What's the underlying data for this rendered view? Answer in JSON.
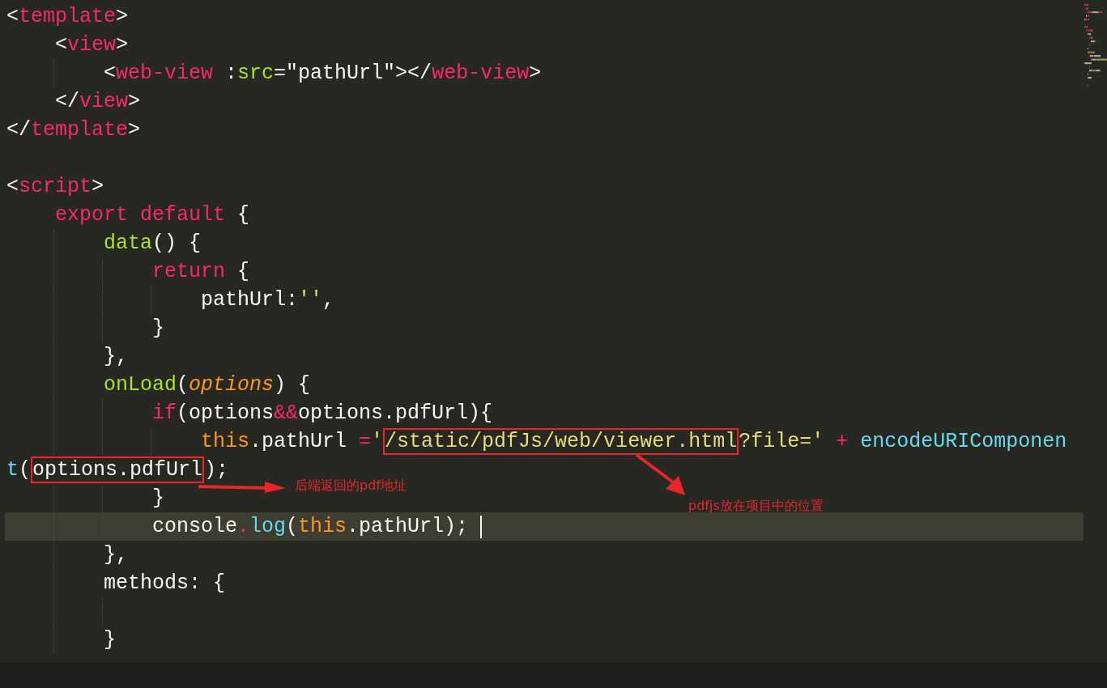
{
  "editor": {
    "lines": [
      {
        "kind": "code",
        "tokens": [
          {
            "text": "<",
            "kind": "punct"
          },
          {
            "text": "template",
            "kind": "tag"
          },
          {
            "text": ">",
            "kind": "punct"
          }
        ],
        "children": [
          {
            "kind": "code",
            "tokens": [
              {
                "text": "<",
                "kind": "punct"
              },
              {
                "text": "view",
                "kind": "tag"
              },
              {
                "text": ">",
                "kind": "punct"
              }
            ],
            "children": [
              {
                "kind": "code",
                "tokens": [
                  {
                    "text": "<",
                    "kind": "punct"
                  },
                  {
                    "text": "web-view",
                    "kind": "tag"
                  },
                  {
                    "text": " :",
                    "kind": "punct"
                  },
                  {
                    "text": "src",
                    "kind": "attr"
                  },
                  {
                    "text": "=\"pathUrl\"></",
                    "kind": "punct"
                  },
                  {
                    "text": "web-view",
                    "kind": "tag"
                  },
                  {
                    "text": ">",
                    "kind": "punct"
                  }
                ]
              }
            ]
          },
          {
            "kind": "code",
            "tokens": [
              {
                "text": "</",
                "kind": "punct"
              },
              {
                "text": "view",
                "kind": "tag"
              },
              {
                "text": ">",
                "kind": "punct"
              }
            ]
          }
        ]
      },
      {
        "kind": "code",
        "tokens": [
          {
            "text": "</",
            "kind": "punct"
          },
          {
            "text": "template",
            "kind": "tag"
          },
          {
            "text": ">",
            "kind": "punct"
          }
        ]
      },
      {
        "kind": "blank"
      },
      {
        "kind": "code",
        "tokens": [
          {
            "text": "<",
            "kind": "punct"
          },
          {
            "text": "script",
            "kind": "tag"
          },
          {
            "text": ">",
            "kind": "punct"
          }
        ],
        "children": [
          {
            "kind": "code",
            "tokens": [
              {
                "text": "export default",
                "kind": "keyword"
              },
              {
                "text": " {",
                "kind": "punct"
              }
            ],
            "children": [
              {
                "kind": "code",
                "tokens": [
                  {
                    "text": "data",
                    "kind": "func"
                  },
                  {
                    "text": "() {",
                    "kind": "punct"
                  }
                ],
                "children": [
                  {
                    "kind": "code",
                    "tokens": [
                      {
                        "text": "return",
                        "kind": "keyword"
                      },
                      {
                        "text": " {",
                        "kind": "punct"
                      }
                    ],
                    "children": [
                      {
                        "kind": "code",
                        "tokens": [
                          {
                            "text": "pathUrl:",
                            "kind": "punct"
                          },
                          {
                            "text": "''",
                            "kind": "string"
                          },
                          {
                            "text": ",",
                            "kind": "punct"
                          }
                        ]
                      }
                    ]
                  },
                  {
                    "kind": "code",
                    "tokens": [
                      {
                        "text": "}",
                        "kind": "punct"
                      }
                    ]
                  }
                ]
              },
              {
                "kind": "code",
                "tokens": [
                  {
                    "text": "},",
                    "kind": "punct"
                  }
                ]
              },
              {
                "kind": "code",
                "tokens": [
                  {
                    "text": "onLoad",
                    "kind": "func"
                  },
                  {
                    "text": "(",
                    "kind": "punct"
                  },
                  {
                    "text": "options",
                    "kind": "param"
                  },
                  {
                    "text": ") {",
                    "kind": "punct"
                  }
                ],
                "children": [
                  {
                    "kind": "code",
                    "tokens": [
                      {
                        "text": "if",
                        "kind": "keyword"
                      },
                      {
                        "text": "(options",
                        "kind": "punct"
                      },
                      {
                        "text": "&&",
                        "kind": "keyword"
                      },
                      {
                        "text": "options.pdfUrl){",
                        "kind": "punct"
                      }
                    ],
                    "children": [
                      {
                        "kind": "code",
                        "tokens": [
                          {
                            "text": "this",
                            "kind": "this"
                          },
                          {
                            "text": ".pathUrl ",
                            "kind": "punct"
                          },
                          {
                            "text": "=",
                            "kind": "keyword"
                          },
                          {
                            "text": "'",
                            "kind": "string"
                          },
                          {
                            "text": "/static/pdfJs/web/viewer.html",
                            "kind": "string",
                            "boxed": true
                          },
                          {
                            "text": "?file='",
                            "kind": "string"
                          },
                          {
                            "text": " + ",
                            "kind": "keyword"
                          },
                          {
                            "text": "encodeURIComponen",
                            "kind": "builtin"
                          }
                        ],
                        "continuation": [
                          {
                            "text": "t",
                            "kind": "builtin"
                          },
                          {
                            "text": "(",
                            "kind": "punct"
                          },
                          {
                            "text": "options.pdfUrl",
                            "kind": "punct",
                            "boxed": true
                          },
                          {
                            "text": ");",
                            "kind": "punct"
                          }
                        ]
                      }
                    ]
                  },
                  {
                    "kind": "code",
                    "tokens": [
                      {
                        "text": "}",
                        "kind": "punct"
                      }
                    ]
                  },
                  {
                    "kind": "code",
                    "highlighted": true,
                    "tokens": [
                      {
                        "text": "console",
                        "kind": "punct"
                      },
                      {
                        "text": ".",
                        "kind": "keyword"
                      },
                      {
                        "text": "log",
                        "kind": "builtin"
                      },
                      {
                        "text": "(",
                        "kind": "punct"
                      },
                      {
                        "text": "this",
                        "kind": "this"
                      },
                      {
                        "text": ".pathUrl); ",
                        "kind": "punct"
                      }
                    ]
                  }
                ]
              },
              {
                "kind": "code",
                "tokens": [
                  {
                    "text": "},",
                    "kind": "punct"
                  }
                ]
              },
              {
                "kind": "code",
                "tokens": [
                  {
                    "text": "methods: {",
                    "kind": "punct"
                  }
                ],
                "children": [
                  {
                    "kind": "blank"
                  }
                ]
              },
              {
                "kind": "code",
                "tokens": [
                  {
                    "text": "}",
                    "kind": "punct"
                  }
                ]
              }
            ]
          }
        ]
      }
    ]
  },
  "annotations": [
    {
      "label": "后端返回的pdf地址"
    },
    {
      "label": "pdfjs放在项目中的位置"
    }
  ]
}
